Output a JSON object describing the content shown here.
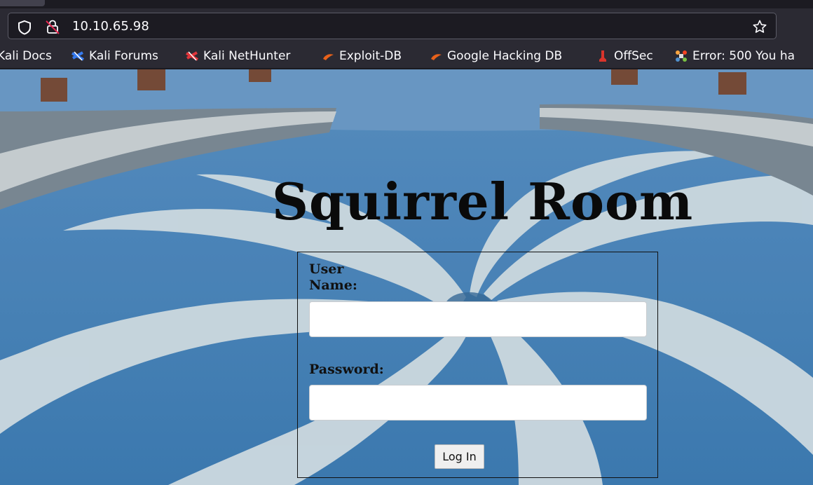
{
  "browser": {
    "url": "10.10.65.98",
    "bookmarks": [
      {
        "label": "Kali Docs",
        "icon": "kali-docs-icon"
      },
      {
        "label": "Kali Forums",
        "icon": "kali-forums-icon"
      },
      {
        "label": "Kali NetHunter",
        "icon": "kali-nethunter-icon"
      },
      {
        "label": "Exploit-DB",
        "icon": "exploit-db-icon"
      },
      {
        "label": "Google Hacking DB",
        "icon": "google-hacking-db-icon"
      },
      {
        "label": "OffSec",
        "icon": "offsec-icon"
      },
      {
        "label": "Error: 500 You ha",
        "icon": "joomla-icon"
      }
    ]
  },
  "page": {
    "title": "Squirrel Room",
    "login": {
      "username_label": "User Name:",
      "password_label": "Password:",
      "username_value": "",
      "password_value": "",
      "submit_label": "Log In"
    }
  },
  "colors": {
    "chrome_bg": "#2b2a33",
    "urlbar_bg": "#1c1b22",
    "page_blue": "#5d93c6",
    "swirl_white": "#d7e4ec"
  }
}
